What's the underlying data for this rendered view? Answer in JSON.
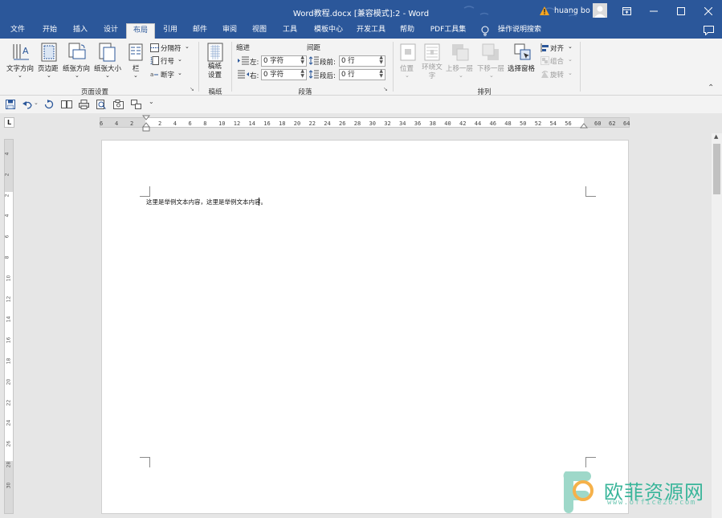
{
  "window": {
    "title": "Word教程.docx [兼容模式]:2  -  Word",
    "user": "huang bo",
    "alert_icon": "warning-icon"
  },
  "tabs": [
    "文件",
    "开始",
    "插入",
    "设计",
    "布局",
    "引用",
    "邮件",
    "审阅",
    "视图",
    "工具",
    "模板中心",
    "开发工具",
    "帮助",
    "PDF工具集"
  ],
  "active_tab": "布局",
  "search_hint": "操作说明搜索",
  "ribbon": {
    "page_setup": {
      "text_direction": "文字方向",
      "margins": "页边距",
      "orientation": "纸张方向",
      "size": "纸张大小",
      "columns": "栏",
      "breaks": "分隔符",
      "line_numbers": "行号",
      "hyphenation": "断字",
      "group": "页面设置"
    },
    "manuscript": {
      "button": "稿纸设置",
      "group": "稿纸"
    },
    "paragraph": {
      "indent_header": "缩进",
      "spacing_header": "间距",
      "left_label": "左:",
      "left_value": "0 字符",
      "right_label": "右:",
      "right_value": "0 字符",
      "before_label": "段前:",
      "before_value": "0 行",
      "after_label": "段后:",
      "after_value": "0 行",
      "group": "段落"
    },
    "arrange": {
      "position": "位置",
      "wrap_text": "环绕文字",
      "bring_forward": "上移一层",
      "send_backward": "下移一层",
      "selection_pane": "选择窗格",
      "align": "对齐",
      "group_btn": "组合",
      "rotate": "旋转",
      "group": "排列"
    }
  },
  "ruler": {
    "left_ticks": [
      "6",
      "4",
      "2"
    ],
    "right_ticks": [
      "2",
      "4",
      "6",
      "8",
      "10",
      "12",
      "14",
      "16",
      "18",
      "20",
      "22",
      "24",
      "26",
      "28",
      "30",
      "32",
      "34",
      "36",
      "38",
      "40",
      "42",
      "44",
      "46",
      "48",
      "50",
      "52",
      "54",
      "56"
    ],
    "end_ticks": [
      "60",
      "62",
      "64"
    ],
    "vertical_ticks": [
      "4",
      "2",
      "2",
      "4",
      "6",
      "8",
      "10",
      "12",
      "14",
      "16",
      "18",
      "20",
      "22",
      "24",
      "26",
      "28",
      "30"
    ]
  },
  "document": {
    "body_text": "这里是举例文本内容，这里是举例文本内容。"
  },
  "watermark": {
    "brand": "欧菲资源网",
    "url": "www.office26.com"
  },
  "colors": {
    "word_blue": "#2b579a",
    "ribbon_bg": "#f3f3f3",
    "watermark_green": "#39b59a"
  }
}
